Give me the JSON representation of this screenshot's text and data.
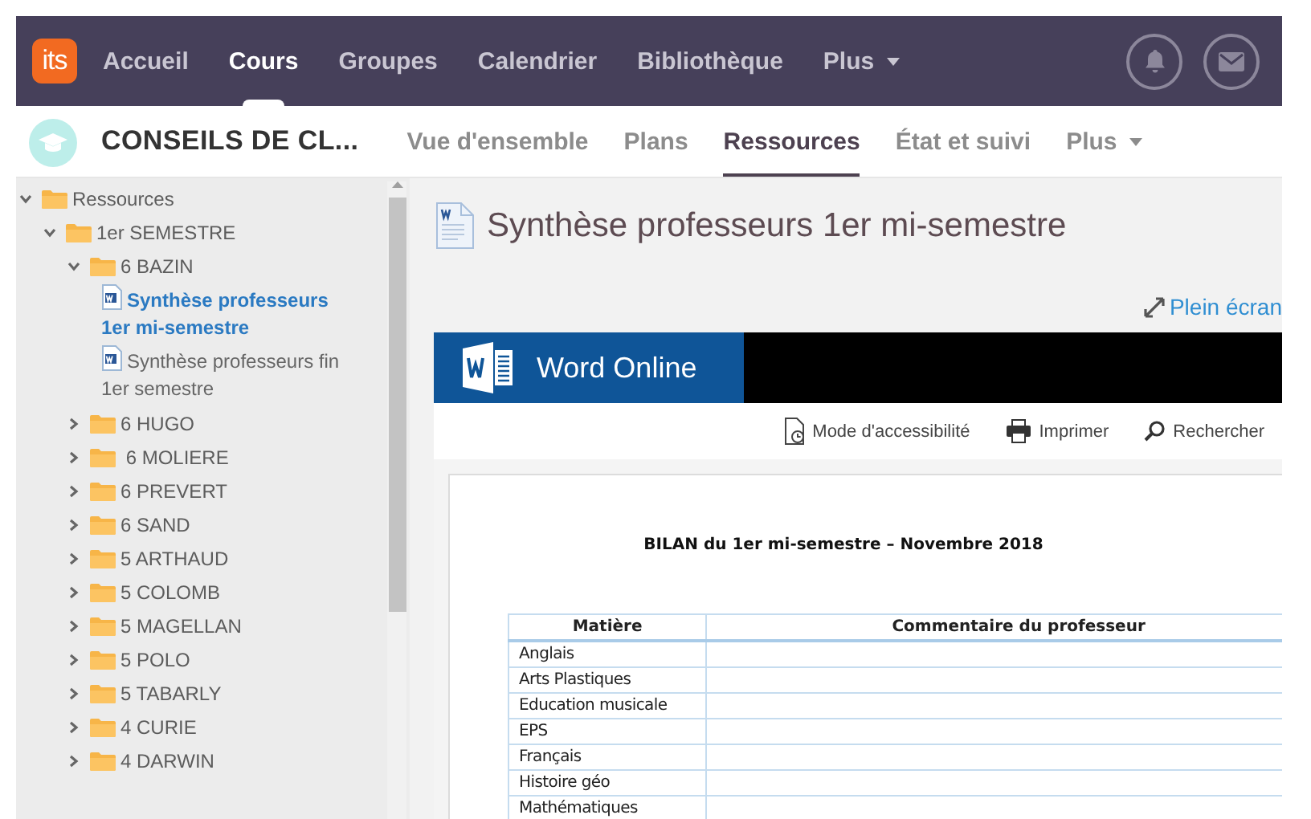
{
  "top_nav": {
    "logo": "its",
    "items": [
      {
        "label": "Accueil",
        "selected": false,
        "kind": "link"
      },
      {
        "label": "Cours",
        "selected": true,
        "kind": "link"
      },
      {
        "label": "Groupes",
        "selected": false,
        "kind": "link"
      },
      {
        "label": "Calendrier",
        "selected": false,
        "kind": "link"
      },
      {
        "label": "Bibliothèque",
        "selected": false,
        "kind": "link"
      },
      {
        "label": "Plus",
        "selected": false,
        "kind": "menu"
      }
    ]
  },
  "course_nav": {
    "title": "CONSEILS DE CL...",
    "tabs": [
      {
        "label": "Vue d'ensemble",
        "selected": false,
        "kind": "link"
      },
      {
        "label": "Plans",
        "selected": false,
        "kind": "link"
      },
      {
        "label": "Ressources",
        "selected": true,
        "kind": "link"
      },
      {
        "label": "État et suivi",
        "selected": false,
        "kind": "link"
      },
      {
        "label": "Plus",
        "selected": false,
        "kind": "menu"
      }
    ]
  },
  "tree": [
    {
      "label": "Ressources",
      "kind": "folder",
      "expanded": true,
      "selected": false,
      "children": [
        {
          "label": "1er SEMESTRE",
          "kind": "folder",
          "expanded": true,
          "selected": false,
          "children": [
            {
              "label": "6 BAZIN",
              "kind": "folder",
              "expanded": true,
              "selected": false,
              "children": [
                {
                  "label": "Synthèse professeurs 1er mi-semestre",
                  "kind": "file",
                  "selected": true
                },
                {
                  "label": "Synthèse professeurs fin 1er semestre",
                  "kind": "file",
                  "selected": false
                }
              ]
            },
            {
              "label": "6 HUGO",
              "kind": "folder",
              "expanded": false,
              "selected": false
            },
            {
              "label": " 6 MOLIERE",
              "kind": "folder",
              "expanded": false,
              "selected": false
            },
            {
              "label": "6 PREVERT",
              "kind": "folder",
              "expanded": false,
              "selected": false
            },
            {
              "label": "6 SAND",
              "kind": "folder",
              "expanded": false,
              "selected": false
            },
            {
              "label": "5 ARTHAUD",
              "kind": "folder",
              "expanded": false,
              "selected": false
            },
            {
              "label": "5 COLOMB",
              "kind": "folder",
              "expanded": false,
              "selected": false
            },
            {
              "label": "5 MAGELLAN",
              "kind": "folder",
              "expanded": false,
              "selected": false
            },
            {
              "label": "5 POLO",
              "kind": "folder",
              "expanded": false,
              "selected": false
            },
            {
              "label": "5 TABARLY",
              "kind": "folder",
              "expanded": false,
              "selected": false
            },
            {
              "label": "4 CURIE",
              "kind": "folder",
              "expanded": false,
              "selected": false
            },
            {
              "label": "4 DARWIN",
              "kind": "folder",
              "expanded": false,
              "selected": false
            }
          ]
        }
      ]
    }
  ],
  "document": {
    "title": "Synthèse professeurs 1er mi-semestre",
    "fullscreen_link": "Plein écran",
    "viewer": {
      "brand": "Word Online",
      "toolbar": [
        {
          "label": "Mode d'accessibilité",
          "kind": "accessibility"
        },
        {
          "label": "Imprimer",
          "kind": "print"
        },
        {
          "label": "Rechercher",
          "kind": "search"
        }
      ],
      "heading": "BILAN du 1er mi-semestre – Novembre 2018",
      "table": {
        "columns": [
          "Matière",
          "Commentaire du professeur"
        ],
        "rows": [
          "Anglais",
          "Arts Plastiques",
          "Education musicale",
          "EPS",
          "Français",
          "Histoire géo",
          "Mathématiques"
        ]
      }
    }
  }
}
